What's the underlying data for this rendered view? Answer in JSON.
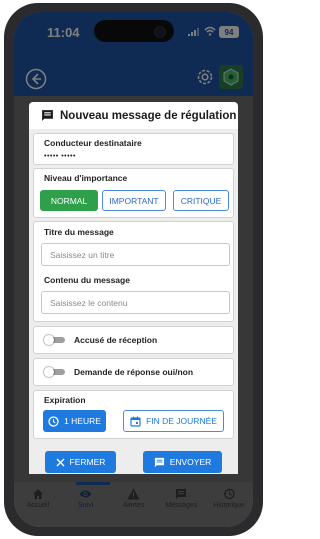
{
  "status_bar": {
    "time": "11:04",
    "battery": "94",
    "signal_icon": "signal-icon",
    "wifi_icon": "wifi-icon"
  },
  "app_bar": {
    "back_icon": "back-arrow-icon",
    "settings_icon": "gear-icon",
    "logo_icon": "logo-icon"
  },
  "dialog": {
    "icon": "message-icon",
    "title": "Nouveau message de régulation",
    "driver": {
      "label": "Conducteur destinataire",
      "value": "••••• •••••"
    },
    "importance": {
      "label": "Niveau d'importance",
      "options": [
        "NORMAL",
        "IMPORTANT",
        "CRITIQUE"
      ],
      "selected": "NORMAL"
    },
    "title_field": {
      "label": "Titre du message",
      "placeholder": "Saisissez un titre"
    },
    "content_field": {
      "label": "Contenu du message",
      "placeholder": "Saisissez le contenu"
    },
    "receipt_toggle": {
      "label": "Accusé de réception",
      "on": false
    },
    "yesno_toggle": {
      "label": "Demande de réponse oui/non",
      "on": false
    },
    "expiration": {
      "label": "Expiration",
      "options": [
        "1 HEURE",
        "FIN DE JOURNÉE"
      ],
      "selected": "1 HEURE"
    },
    "close_label": "FERMER",
    "send_label": "ENVOYER"
  },
  "bottom_nav": {
    "active": "Suivi",
    "items": [
      {
        "label": "Accueil",
        "icon": "home-icon"
      },
      {
        "label": "Suivi",
        "icon": "eye-icon"
      },
      {
        "label": "Alertes",
        "icon": "warning-icon"
      },
      {
        "label": "Messages",
        "icon": "message-icon"
      },
      {
        "label": "Historique",
        "icon": "history-icon"
      }
    ]
  },
  "colors": {
    "primary": "#1f56a8",
    "button_blue": "#1f7ae0",
    "selected_green": "#2f9f4b",
    "dialog_body": "#ededed"
  }
}
